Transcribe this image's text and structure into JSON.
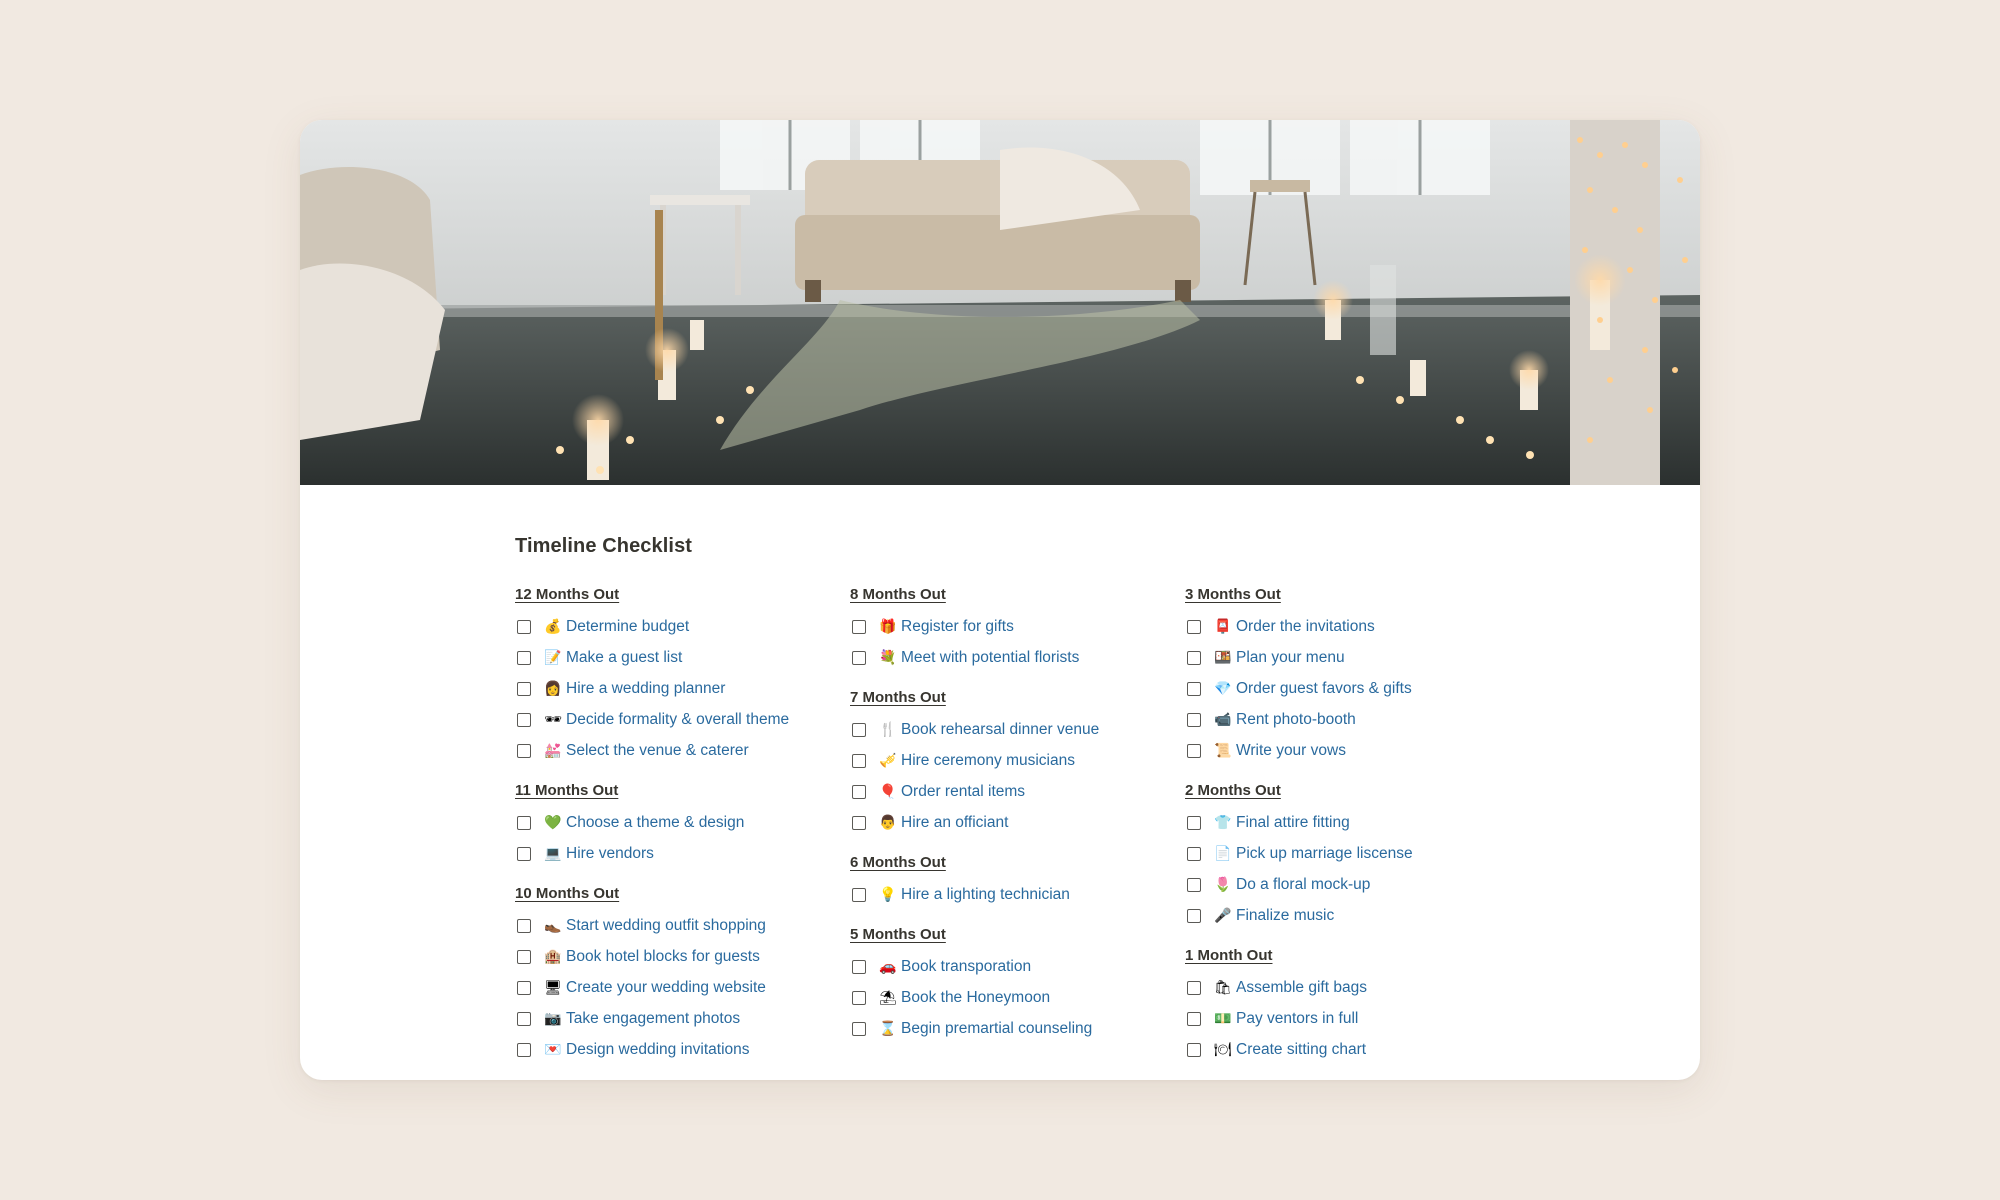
{
  "page": {
    "title": "Timeline Checklist",
    "accent_link_color": "#2a6a9e",
    "background": "#f1e9e1"
  },
  "columns": [
    {
      "sections": [
        {
          "title": "12 Months Out",
          "items": [
            {
              "icon": "money-bag-icon",
              "glyph": "💰",
              "label": "Determine budget"
            },
            {
              "icon": "memo-icon",
              "glyph": "📝",
              "label": "Make a guest list"
            },
            {
              "icon": "woman-icon",
              "glyph": "👩",
              "label": "Hire a wedding planner"
            },
            {
              "icon": "sunglasses-icon",
              "glyph": "🕶",
              "label": "Decide formality & overall theme"
            },
            {
              "icon": "wedding-icon",
              "glyph": "💒",
              "label": "Select the venue & caterer"
            }
          ]
        },
        {
          "title": "11 Months Out",
          "items": [
            {
              "icon": "green-heart-icon",
              "glyph": "💚",
              "label": "Choose a theme & design"
            },
            {
              "icon": "laptop-icon",
              "glyph": "💻",
              "label": "Hire vendors"
            }
          ]
        },
        {
          "title": "10 Months Out",
          "items": [
            {
              "icon": "shoe-icon",
              "glyph": "👞",
              "label": "Start wedding outfit shopping"
            },
            {
              "icon": "hotel-icon",
              "glyph": "🏨",
              "label": "Book hotel blocks for guests"
            },
            {
              "icon": "desktop-icon",
              "glyph": "🖥",
              "label": "Create your wedding website"
            },
            {
              "icon": "camera-icon",
              "glyph": "📷",
              "label": "Take engagement photos"
            },
            {
              "icon": "love-letter-icon",
              "glyph": "💌",
              "label": "Design wedding invitations"
            }
          ]
        }
      ]
    },
    {
      "sections": [
        {
          "title": "8 Months Out",
          "items": [
            {
              "icon": "gift-icon",
              "glyph": "🎁",
              "label": "Register for gifts"
            },
            {
              "icon": "bouquet-icon",
              "glyph": "💐",
              "label": "Meet with potential florists"
            }
          ]
        },
        {
          "title": "7 Months Out",
          "items": [
            {
              "icon": "fork-knife-icon",
              "glyph": "🍴",
              "label": "Book rehearsal dinner venue"
            },
            {
              "icon": "trumpet-icon",
              "glyph": "🎺",
              "label": "Hire ceremony musicians"
            },
            {
              "icon": "balloon-icon",
              "glyph": "🎈",
              "label": "Order rental items"
            },
            {
              "icon": "man-icon",
              "glyph": "👨",
              "label": "Hire an officiant"
            }
          ]
        },
        {
          "title": "6 Months Out",
          "items": [
            {
              "icon": "light-bulb-icon",
              "glyph": "💡",
              "label": "Hire a lighting technician"
            }
          ]
        },
        {
          "title": "5 Months Out",
          "items": [
            {
              "icon": "car-icon",
              "glyph": "🚗",
              "label": "Book transporation"
            },
            {
              "icon": "beach-umbrella-icon",
              "glyph": "⛱",
              "label": "Book the Honeymoon"
            },
            {
              "icon": "hourglass-icon",
              "glyph": "⌛",
              "label": "Begin premartial counseling"
            }
          ]
        }
      ]
    },
    {
      "sections": [
        {
          "title": "3 Months Out",
          "items": [
            {
              "icon": "mailbox-icon",
              "glyph": "📮",
              "label": "Order the invitations"
            },
            {
              "icon": "bento-icon",
              "glyph": "🍱",
              "label": "Plan your menu"
            },
            {
              "icon": "diamond-icon",
              "glyph": "💎",
              "label": "Order guest favors & gifts"
            },
            {
              "icon": "video-camera-icon",
              "glyph": "📹",
              "label": "Rent photo-booth"
            },
            {
              "icon": "scroll-icon",
              "glyph": "📜",
              "label": "Write your vows"
            }
          ]
        },
        {
          "title": "2 Months Out",
          "items": [
            {
              "icon": "shirt-icon",
              "glyph": "👕",
              "label": "Final attire fitting"
            },
            {
              "icon": "document-icon",
              "glyph": "📄",
              "label": "Pick up marriage liscense"
            },
            {
              "icon": "tulip-icon",
              "glyph": "🌷",
              "label": "Do a floral mock-up"
            },
            {
              "icon": "microphone-icon",
              "glyph": "🎤",
              "label": "Finalize music"
            }
          ]
        },
        {
          "title": "1 Month Out",
          "items": [
            {
              "icon": "shopping-bags-icon",
              "glyph": "🛍",
              "label": "Assemble gift bags"
            },
            {
              "icon": "money-icon",
              "glyph": "💵",
              "label": "Pay ventors in full"
            },
            {
              "icon": "place-card-icon",
              "glyph": "🍽",
              "label": "Create sitting chart"
            }
          ]
        }
      ]
    }
  ]
}
